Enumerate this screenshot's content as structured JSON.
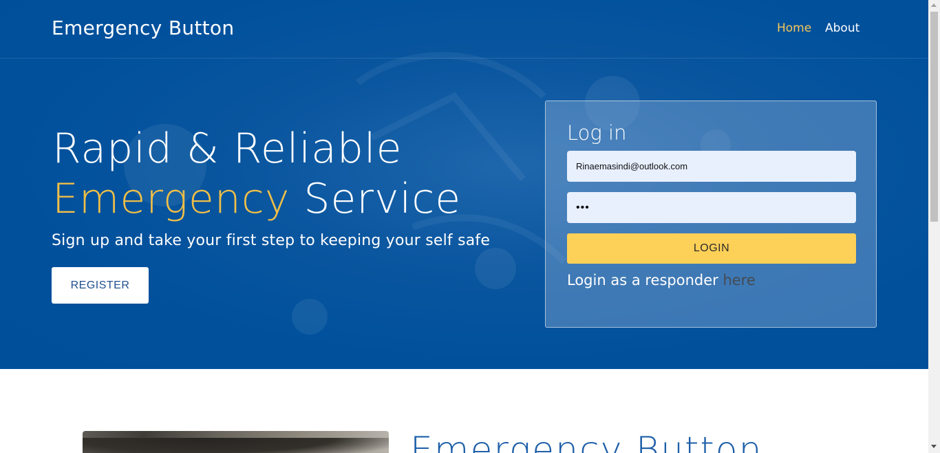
{
  "navbar": {
    "brand": "Emergency Button",
    "links": [
      {
        "label": "Home",
        "active": true
      },
      {
        "label": "About",
        "active": false
      }
    ]
  },
  "hero": {
    "headline_line1": "Rapid & Reliable",
    "headline_accent": "Emergency",
    "headline_rest": " Service",
    "subline": "Sign up and take your first step to keeping your self safe",
    "register_label": "REGISTER"
  },
  "login": {
    "title": "Log in",
    "email_value": "Rinaemasindi@outlook.com",
    "password_value": "•••",
    "button_label": "LOGIN",
    "responder_text": "Login as a responder ",
    "responder_link": "here"
  },
  "section": {
    "heading": "Emergency Button"
  },
  "colors": {
    "hero_bg": "#00509c",
    "accent_gold": "#f0bf47",
    "login_button": "#fdd057",
    "input_bg": "#e8f0fe"
  }
}
